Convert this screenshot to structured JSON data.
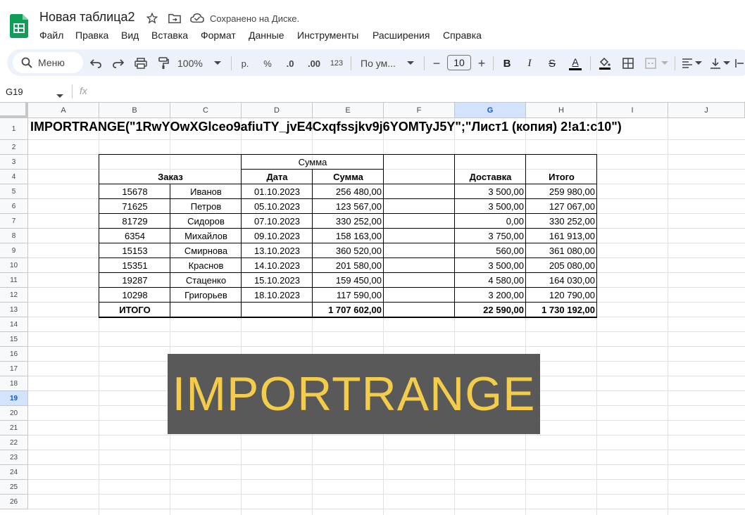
{
  "app": {
    "title": "Новая таблица2",
    "save_status": "Сохранено на Диске.",
    "brand_color": "#0f9d58"
  },
  "menu": [
    "Файл",
    "Правка",
    "Вид",
    "Вставка",
    "Формат",
    "Данные",
    "Инструменты",
    "Расширения",
    "Справка"
  ],
  "toolbar": {
    "search_label": "Меню",
    "zoom": "100%",
    "currency": "р.",
    "percent": "%",
    "dec_decrease": ".0",
    "dec_increase": ".00",
    "number_format": "123",
    "font_name": "По ум...",
    "font_size": "10",
    "bold": "B",
    "italic": "I",
    "strikethrough": "S",
    "text_color": "A",
    "minus": "−",
    "plus": "+"
  },
  "formula_bar": {
    "name_box": "G19",
    "fx": "fx"
  },
  "columns": [
    "A",
    "B",
    "C",
    "D",
    "E",
    "F",
    "G",
    "H",
    "I",
    "J"
  ],
  "selected_column": "G",
  "rows": [
    "1",
    "2",
    "3",
    "4",
    "5",
    "6",
    "7",
    "8",
    "9",
    "10",
    "11",
    "12",
    "13",
    "14",
    "15",
    "16",
    "17",
    "18",
    "19",
    "20",
    "21",
    "22",
    "23",
    "24",
    "25",
    "26"
  ],
  "selected_row": "19",
  "sheet": {
    "formula_text": "IMPORTRANGE(\"1RwYOwXGlceo9afiuTY_jvE4Cxqfssjkv9j6YOMTyJ5Y\";\"Лист1 (копия) 2!a1:c10\")",
    "header": {
      "summa_group": "Сумма",
      "order": "Заказ",
      "date": "Дата",
      "sum": "Сумма",
      "delivery": "Доставка",
      "total": "Итого"
    },
    "rows": [
      {
        "id": "15678",
        "name": "Иванов",
        "date": "01.10.2023",
        "sum": "256 480,00",
        "delivery": "3 500,00",
        "total": "259 980,00"
      },
      {
        "id": "71625",
        "name": "Петров",
        "date": "05.10.2023",
        "sum": "123 567,00",
        "delivery": "3 500,00",
        "total": "127 067,00"
      },
      {
        "id": "81729",
        "name": "Сидоров",
        "date": "07.10.2023",
        "sum": "330 252,00",
        "delivery": "0,00",
        "total": "330 252,00"
      },
      {
        "id": "6354",
        "name": "Михайлов",
        "date": "09.10.2023",
        "sum": "158 163,00",
        "delivery": "3 750,00",
        "total": "161 913,00"
      },
      {
        "id": "15153",
        "name": "Смирнова",
        "date": "13.10.2023",
        "sum": "360 520,00",
        "delivery": "560,00",
        "total": "361 080,00"
      },
      {
        "id": "15351",
        "name": "Краснов",
        "date": "14.10.2023",
        "sum": "201 580,00",
        "delivery": "3 500,00",
        "total": "205 080,00"
      },
      {
        "id": "19287",
        "name": "Стаценко",
        "date": "15.10.2023",
        "sum": "159 450,00",
        "delivery": "4 580,00",
        "total": "164 030,00"
      },
      {
        "id": "10298",
        "name": "Григорьев",
        "date": "18.10.2023",
        "sum": "117 590,00",
        "delivery": "3 200,00",
        "total": "120 790,00"
      }
    ],
    "totals": {
      "label": "ИТОГО",
      "sum": "1 707 602,00",
      "delivery": "22 590,00",
      "total": "1 730 192,00"
    }
  },
  "overlay": {
    "text": "IMPORTRANGE",
    "text_color": "#f2cc4a",
    "bg_color": "#595959"
  }
}
